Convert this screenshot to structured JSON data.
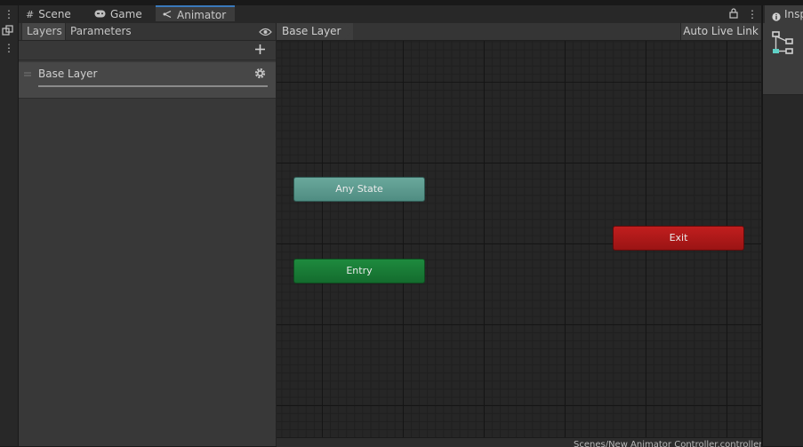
{
  "tabs": [
    {
      "label": "Scene",
      "icon": "grid-icon"
    },
    {
      "label": "Game",
      "icon": "gamepad-icon"
    },
    {
      "label": "Animator",
      "icon": "animator-icon",
      "active": true
    }
  ],
  "left_panel": {
    "tabs": [
      "Layers",
      "Parameters"
    ],
    "active_tab": "Layers",
    "layers": [
      {
        "name": "Base Layer"
      }
    ]
  },
  "graph": {
    "breadcrumb": "Base Layer",
    "auto_live_link_label": "Auto Live Link",
    "nodes": {
      "any_state": "Any State",
      "entry": "Entry",
      "exit": "Exit"
    },
    "footer_path": "Scenes/New Animator Controller.controller"
  },
  "inspector": {
    "tab_label": "Inspector",
    "icon": "info-icon"
  },
  "colors": {
    "any_state": "#5f9d92",
    "entry": "#1a7d37",
    "exit": "#b01a1a",
    "active_tab_accent": "#3a79bb"
  }
}
